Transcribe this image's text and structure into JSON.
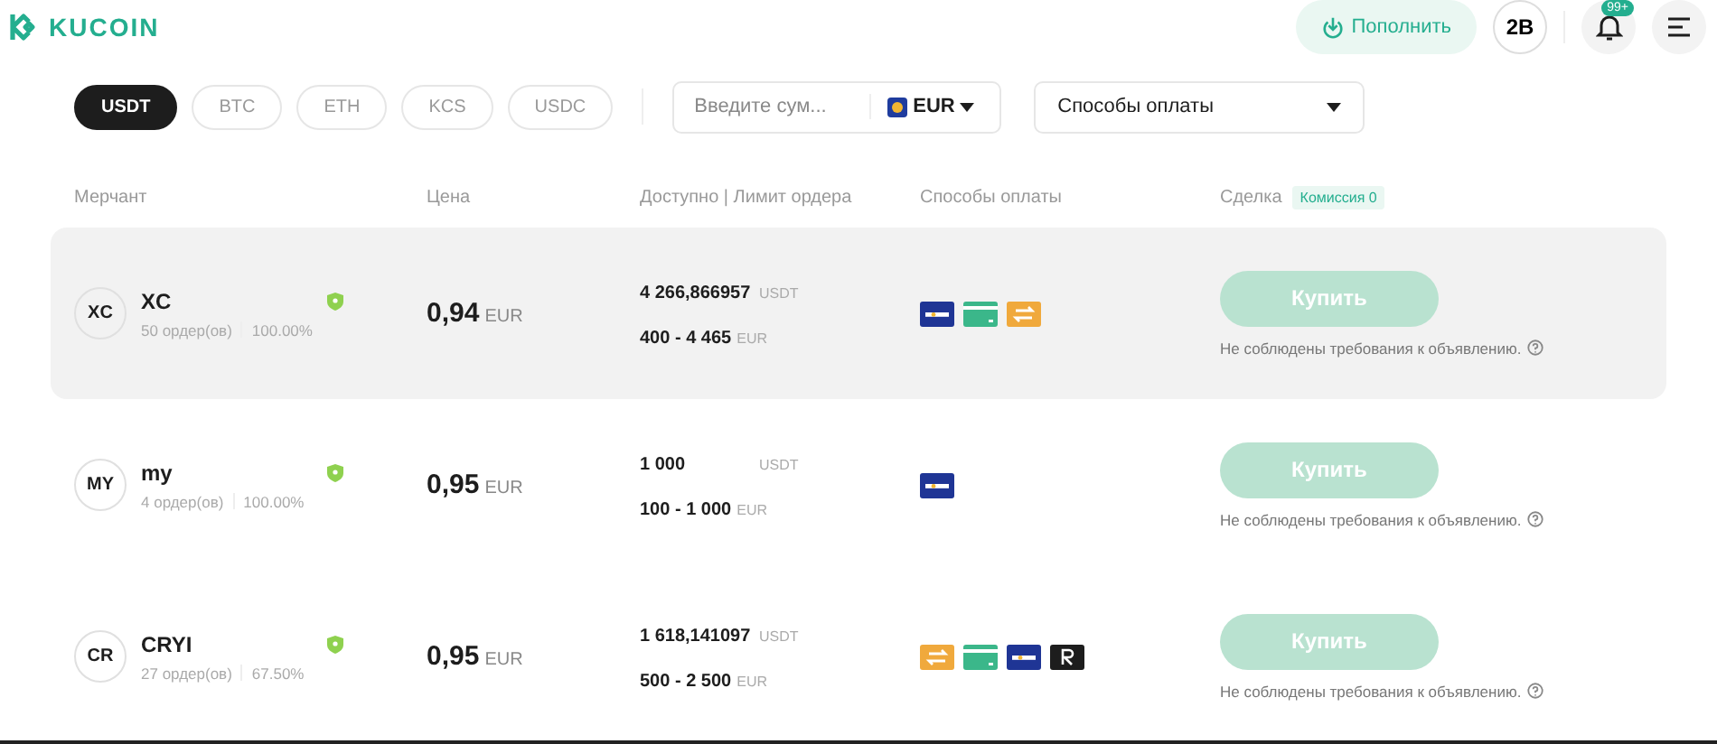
{
  "header": {
    "logo": "KUCOIN",
    "deposit_button": "Пополнить",
    "avatar": "2B",
    "notification_badge": "99+"
  },
  "coin_tabs": [
    {
      "label": "USDT",
      "selected": true
    },
    {
      "label": "BTC",
      "selected": false
    },
    {
      "label": "ETH",
      "selected": false
    },
    {
      "label": "KCS",
      "selected": false
    },
    {
      "label": "USDC",
      "selected": false
    }
  ],
  "amount_field": {
    "placeholder": "Введите сум...",
    "currency": "EUR"
  },
  "payment_filter": {
    "value": "Способы оплаты"
  },
  "table": {
    "columns": [
      "Мерчант",
      "Цена",
      "Доступно | Лимит ордера",
      "Способы оплаты",
      "Сделка"
    ],
    "fee_badge": "Комиссия 0",
    "rows": [
      {
        "highlighted": true,
        "initials": "XC",
        "name": "XC",
        "orders": "50 ордер(ов)",
        "completion": "100.00%",
        "price": "0,94",
        "price_currency": "EUR",
        "available": "4 266,866957",
        "available_currency": "USDT",
        "limit": "400 - 4 465",
        "limit_currency": "EUR",
        "payments": [
          {
            "kind": "sepa"
          },
          {
            "kind": "card"
          },
          {
            "kind": "transfer"
          }
        ],
        "action": "Купить",
        "note": "Не соблюдены требования к объявлению."
      },
      {
        "highlighted": false,
        "initials": "MY",
        "name": "my",
        "orders": "4 ордер(ов)",
        "completion": "100.00%",
        "price": "0,95",
        "price_currency": "EUR",
        "available": "1 000",
        "available_currency": "USDT",
        "limit": "100 - 1 000",
        "limit_currency": "EUR",
        "payments": [
          {
            "kind": "sepa"
          }
        ],
        "action": "Купить",
        "note": "Не соблюдены требования к объявлению."
      },
      {
        "highlighted": false,
        "initials": "CR",
        "name": "CRYI",
        "orders": "27 ордер(ов)",
        "completion": "67.50%",
        "price": "0,95",
        "price_currency": "EUR",
        "available": "1 618,141097",
        "available_currency": "USDT",
        "limit": "500 - 2 500",
        "limit_currency": "EUR",
        "payments": [
          {
            "kind": "transfer"
          },
          {
            "kind": "card"
          },
          {
            "kind": "sepa"
          },
          {
            "kind": "revolut"
          }
        ],
        "action": "Купить",
        "note": "Не соблюдены требования к объявлению."
      }
    ]
  }
}
